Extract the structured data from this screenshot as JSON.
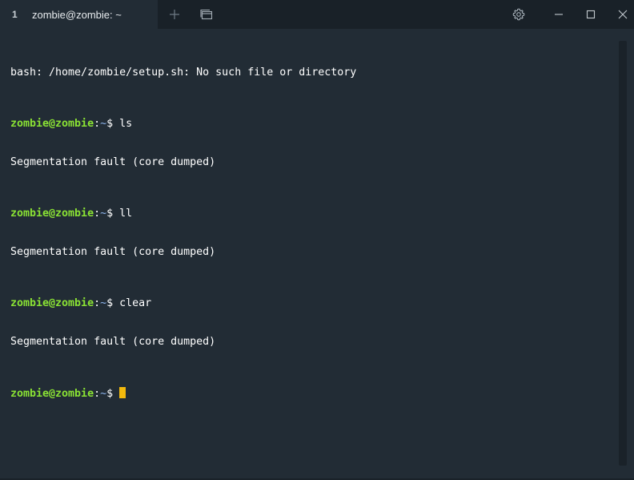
{
  "tab": {
    "index": "1",
    "title": "zombie@zombie: ~"
  },
  "icons": {
    "new_tab": "plus-icon",
    "tab_overview": "window-stack-icon",
    "settings": "gear-icon",
    "minimize": "minimize-icon",
    "maximize": "maximize-icon",
    "close": "close-icon"
  },
  "colors": {
    "background": "#222c35",
    "titlebar": "#192128",
    "prompt_user": "#8ae234",
    "prompt_path": "#8fb7f0",
    "cursor": "#f2b90d",
    "text": "#ffffff"
  },
  "terminal": {
    "error_line": "bash: /home/zombie/setup.sh: No such file or directory",
    "prompt": {
      "user_host": "zombie@zombie",
      "separator": ":",
      "path": "~",
      "symbol": "$ "
    },
    "commands": [
      {
        "command": "ls",
        "output": "Segmentation fault (core dumped)"
      },
      {
        "command": "ll",
        "output": "Segmentation fault (core dumped)"
      },
      {
        "command": "clear",
        "output": "Segmentation fault (core dumped)"
      }
    ]
  }
}
